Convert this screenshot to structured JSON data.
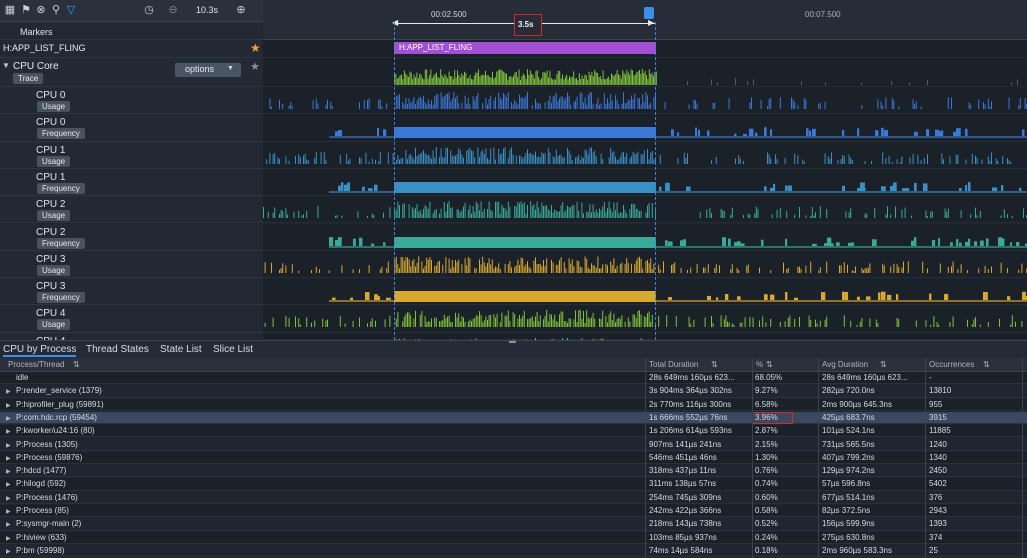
{
  "toolbar": {
    "icons": [
      "grid-icon",
      "flag-icon",
      "close-circle-icon",
      "search-icon",
      "filter-icon",
      "zoom-out-icon",
      "zoom-minus-icon",
      "zoom-in-icon"
    ],
    "duration": "10.3s"
  },
  "ruler": {
    "time_left": "00:02.500",
    "time_right": "00:07.500",
    "selection_span": "3.5s"
  },
  "markers_label": "Markers",
  "fling_row": {
    "label": "H:APP_LIST_FLING",
    "slice_label": "H:APP_LIST_FLING",
    "slice_color": "#a24fd4",
    "star_color": "#f0a030"
  },
  "cpu_core": {
    "label": "CPU Core",
    "trace_badge": "Trace",
    "options": "options"
  },
  "cpu_rows": [
    {
      "name": "CPU 0",
      "kind": "Usage"
    },
    {
      "name": "CPU 0",
      "kind": "Frequency"
    },
    {
      "name": "CPU 1",
      "kind": "Usage"
    },
    {
      "name": "CPU 1",
      "kind": "Frequency"
    },
    {
      "name": "CPU 2",
      "kind": "Usage"
    },
    {
      "name": "CPU 2",
      "kind": "Frequency"
    },
    {
      "name": "CPU 3",
      "kind": "Usage"
    },
    {
      "name": "CPU 3",
      "kind": "Frequency"
    },
    {
      "name": "CPU 4",
      "kind": "Usage"
    },
    {
      "name": "CPU 4",
      "kind": ""
    }
  ],
  "track_colors": {
    "core": "#7ec23a",
    "cpu0": "#3b78d8",
    "cpu1": "#3a8fc4",
    "cpu2": "#3aa99a",
    "cpu3": "#d8a830",
    "cpu4": "#7ec23a"
  },
  "tabs": [
    "CPU by Process",
    "Thread States",
    "State List",
    "Slice List"
  ],
  "table": {
    "headers": [
      "Process/Thread",
      "Total Duration",
      "%",
      "Avg Duration",
      "Occurrences"
    ],
    "rows": [
      [
        "idle",
        "28s 649ms 160µs 623...",
        "68.05%",
        "28s 649ms 160µs 623...",
        "-"
      ],
      [
        "P:render_service (1379)",
        "3s 904ms 364µs 302ns",
        "9.27%",
        "282µs 720.0ns",
        "13810"
      ],
      [
        "P:hiprofiler_plug (59891)",
        "2s 770ms 116µs 300ns",
        "6.58%",
        "2ms 900µs 645.3ns",
        "955"
      ],
      [
        "P:com.hdc.rcp (59454)",
        "1s 666ms 552µs 76ns",
        "3.96%",
        "425µs 683.7ns",
        "3915"
      ],
      [
        "P:kworker/u24:16 (80)",
        "1s 206ms 614µs 593ns",
        "2.87%",
        "101µs 524.1ns",
        "11885"
      ],
      [
        "P:Process (1305)",
        "907ms 141µs 241ns",
        "2.15%",
        "731µs 565.5ns",
        "1240"
      ],
      [
        "P:Process (59876)",
        "546ms 451µs 46ns",
        "1.30%",
        "407µs 799.2ns",
        "1340"
      ],
      [
        "P:hdcd (1477)",
        "318ms 437µs 11ns",
        "0.76%",
        "129µs 974.2ns",
        "2450"
      ],
      [
        "P:hilogd (592)",
        "311ms 138µs 57ns",
        "0.74%",
        "57µs 596.8ns",
        "5402"
      ],
      [
        "P:Process (1476)",
        "254ms 745µs 309ns",
        "0.60%",
        "677µs 514.1ns",
        "376"
      ],
      [
        "P:Process (85)",
        "242ms 422µs 366ns",
        "0.58%",
        "82µs 372.5ns",
        "2943"
      ],
      [
        "P:sysmgr-main (2)",
        "218ms 143µs 738ns",
        "0.52%",
        "156µs 599.9ns",
        "1393"
      ],
      [
        "P:hiview (633)",
        "103ms 85µs 937ns",
        "0.24%",
        "275µs 630.8ns",
        "374"
      ],
      [
        "P:bm (59998)",
        "74ms 14µs 584ns",
        "0.18%",
        "2ms 960µs 583.3ns",
        "25"
      ]
    ],
    "selected_row": 3
  }
}
